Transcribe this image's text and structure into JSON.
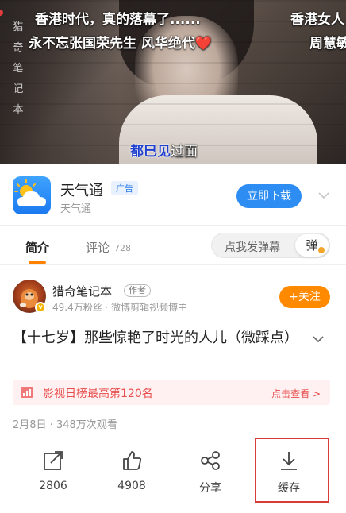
{
  "video": {
    "top_left_text": "香港时代，真的落幕了......",
    "top_left_text2": "永不忘张国荣先生 风华绝代❤️",
    "top_right_text": "香港女人",
    "top_right_text2": "周慧敏",
    "side_label": [
      "猎",
      "奇",
      "笔",
      "记",
      "本"
    ],
    "caption_blue": "都巳见",
    "caption_white": "过面"
  },
  "ad": {
    "title": "天气通",
    "badge": "广告",
    "subtitle": "天气通",
    "button": "立即下载"
  },
  "tabs": {
    "intro": "简介",
    "comment": "评论",
    "comment_count": "728",
    "danmu_placeholder": "点我发弹幕",
    "danmu_toggle": "弹"
  },
  "author": {
    "name": "猎奇笔记本",
    "tag": "作者",
    "meta": "49.4万粉丝 · 微博剪辑视频博主",
    "follow": "+关注"
  },
  "video_title": "【十七岁】那些惊艳了时光的人儿（微踩点）",
  "ranking": {
    "text": "影视日榜最高第120名",
    "link": "点击查看 >"
  },
  "date_views": "2月8日 · 348万次观看",
  "actions": {
    "share_count": "2806",
    "like_count": "4908",
    "share_label": "分享",
    "cache_label": "缓存"
  },
  "colors": {
    "accent_orange": "#ff8200",
    "ad_button_blue": "#2e8df2",
    "rank_red": "#e84d4d",
    "highlight_box": "#d93a3a"
  }
}
